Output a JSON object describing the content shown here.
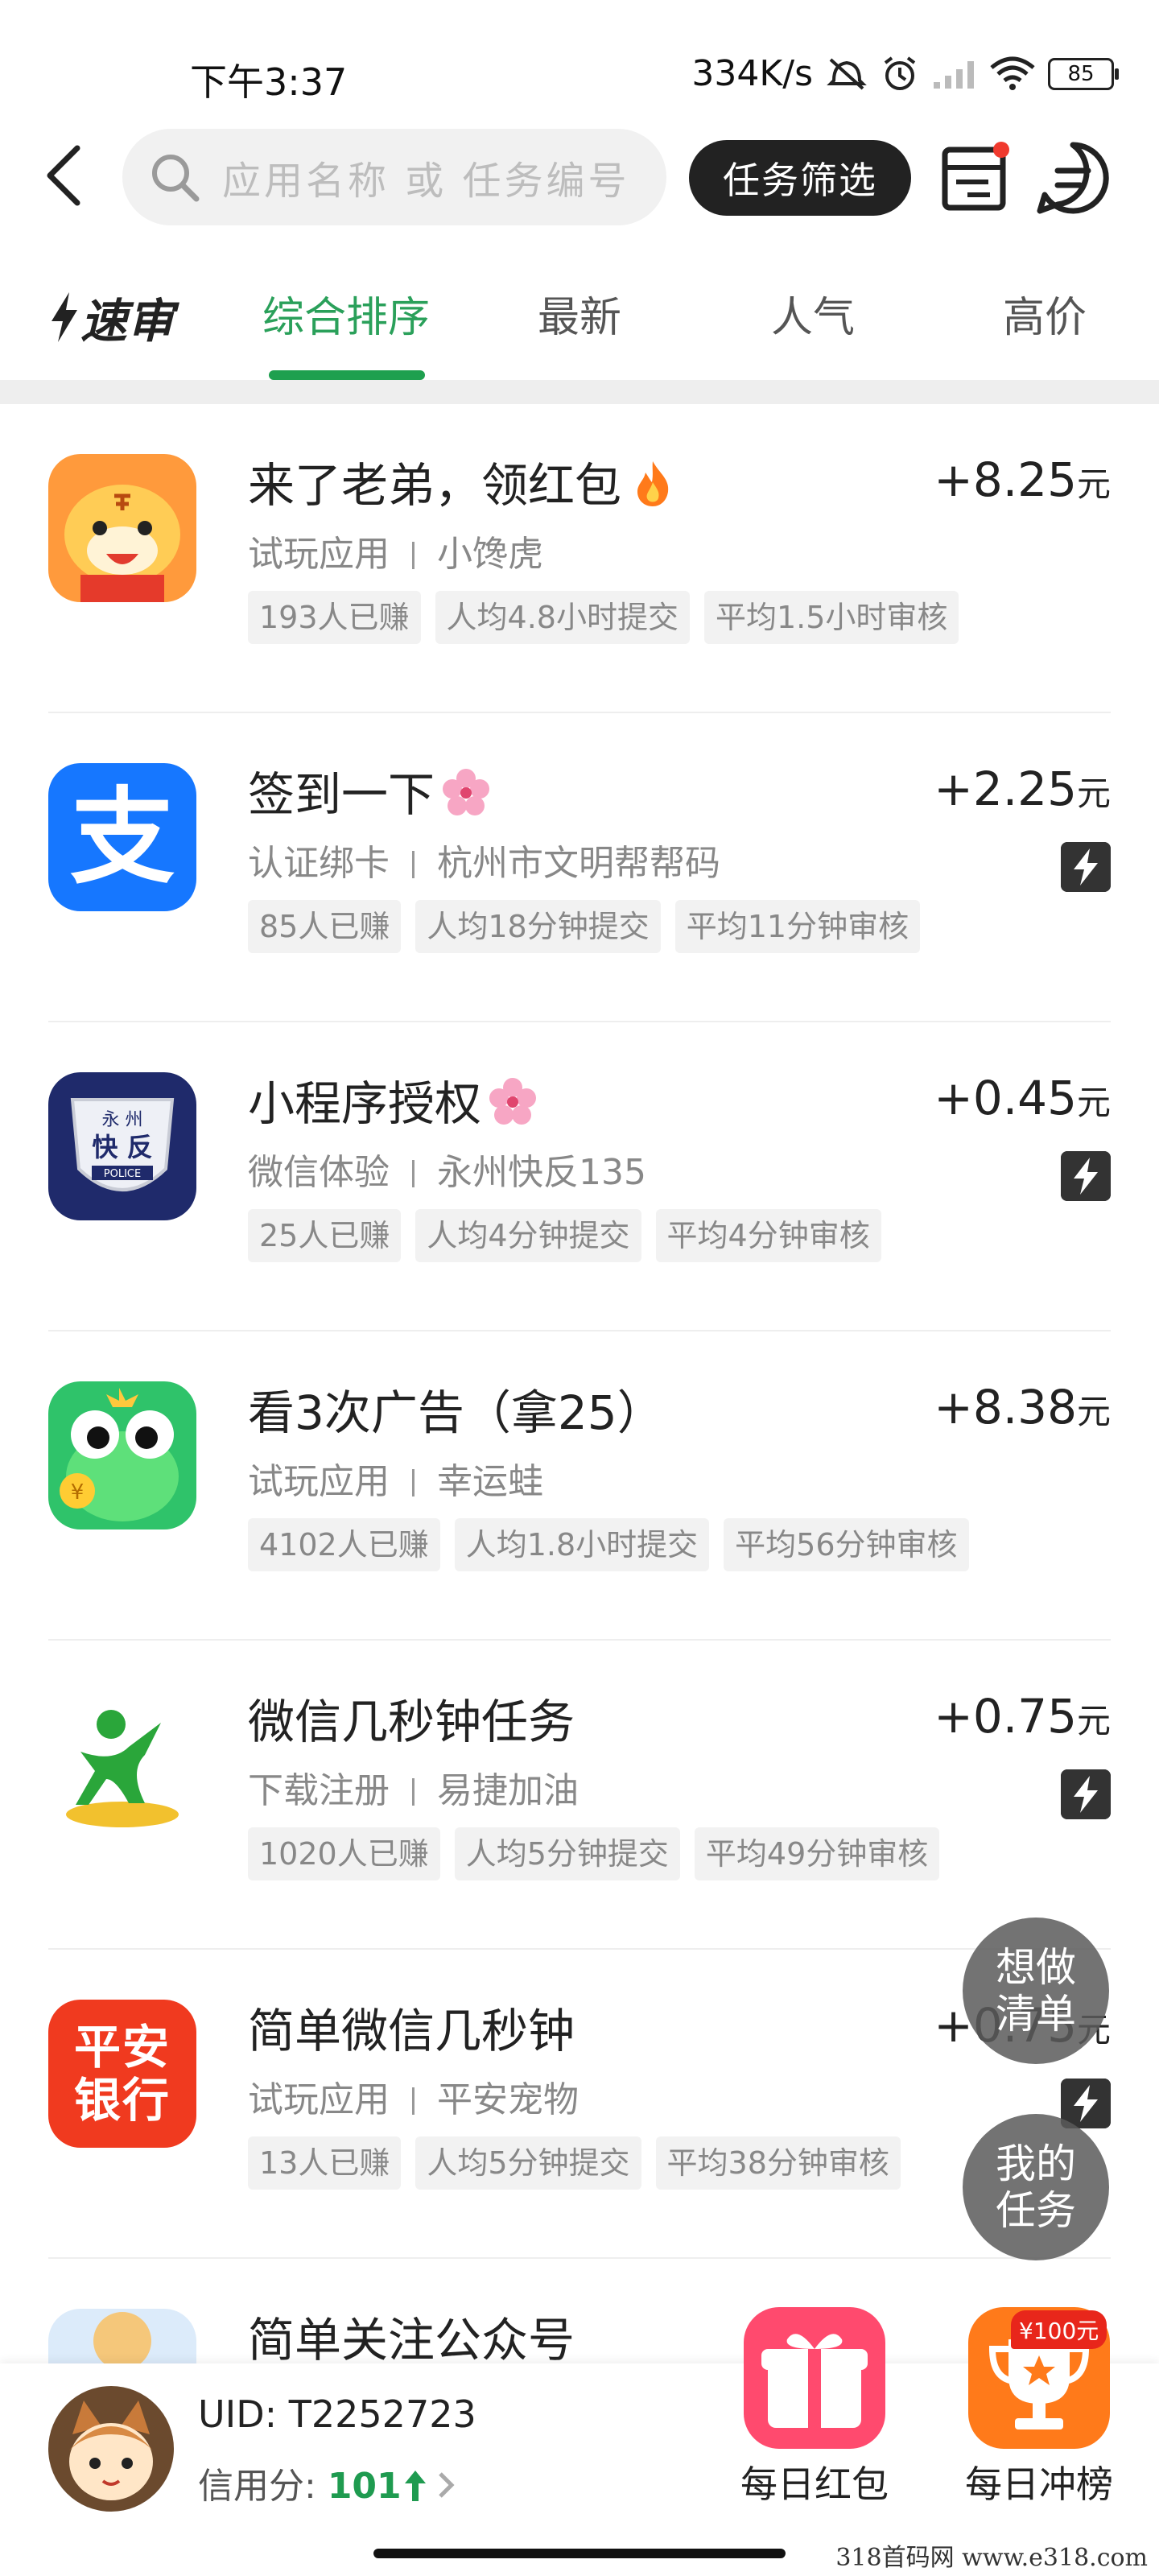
{
  "status_bar": {
    "time": "下午3:37",
    "speed": "334K/s",
    "battery": "85",
    "icons": [
      "mute-icon",
      "alarm-icon",
      "signal-icon",
      "wifi-icon",
      "battery-icon"
    ]
  },
  "header": {
    "search_placeholder": "应用名称 或 任务编号",
    "filter_label": "任务筛选"
  },
  "tabs": {
    "speed_label": "速审",
    "items": [
      "综合排序",
      "最新",
      "人气",
      "高价"
    ],
    "active": 0
  },
  "tasks": [
    {
      "title": "来了老弟，领红包",
      "emoji": "fire",
      "category": "试玩应用",
      "app": "小馋虎",
      "price": "+8.25",
      "unit": "元",
      "fast": false,
      "tags": [
        "193人已赚",
        "人均4.8小时提交",
        "平均1.5小时审核"
      ]
    },
    {
      "title": "签到一下",
      "emoji": "flower",
      "category": "认证绑卡",
      "app": "杭州市文明帮帮码",
      "price": "+2.25",
      "unit": "元",
      "fast": true,
      "tags": [
        "85人已赚",
        "人均18分钟提交",
        "平均11分钟审核"
      ]
    },
    {
      "title": "小程序授权",
      "emoji": "flower",
      "category": "微信体验",
      "app": "永州快反135",
      "price": "+0.45",
      "unit": "元",
      "fast": true,
      "tags": [
        "25人已赚",
        "人均4分钟提交",
        "平均4分钟审核"
      ]
    },
    {
      "title": "看3次广告（拿25）",
      "emoji": "",
      "category": "试玩应用",
      "app": "幸运蛙",
      "price": "+8.38",
      "unit": "元",
      "fast": false,
      "tags": [
        "4102人已赚",
        "人均1.8小时提交",
        "平均56分钟审核"
      ]
    },
    {
      "title": "微信几秒钟任务",
      "emoji": "",
      "category": "下载注册",
      "app": "易捷加油",
      "price": "+0.75",
      "unit": "元",
      "fast": true,
      "tags": [
        "1020人已赚",
        "人均5分钟提交",
        "平均49分钟审核"
      ]
    },
    {
      "title": "简单微信几秒钟",
      "emoji": "",
      "category": "试玩应用",
      "app": "平安宠物",
      "price": "+0.75",
      "unit": "元",
      "fast": true,
      "tags": [
        "13人已赚",
        "人均5分钟提交",
        "平均38分钟审核"
      ]
    },
    {
      "title": "简单关注公众号",
      "emoji": "",
      "category": "",
      "app": "",
      "price": "+",
      "unit": "",
      "fast": false,
      "tags": []
    }
  ],
  "icon_texts": {
    "alipay": "支",
    "police_top": "永 州",
    "police_mid": "快 反",
    "police_bottom": "POLICE",
    "pingan_line1": "平安",
    "pingan_line2": "银行",
    "frog_coin": "¥"
  },
  "floating": {
    "want_label": "想做清单",
    "my_tasks_label": "我的任务"
  },
  "bottom": {
    "uid": "UID: T2252723",
    "credit_label": "信用分: ",
    "credit_value": "101",
    "daily_redpack": "每日红包",
    "daily_rank": "每日冲榜",
    "rank_badge": "¥100元"
  },
  "watermark": "318首码网  www.e318.com",
  "colors": {
    "accent": "#1ea04f",
    "dark_button": "#222222",
    "tag_bg": "#f2f2f2"
  }
}
